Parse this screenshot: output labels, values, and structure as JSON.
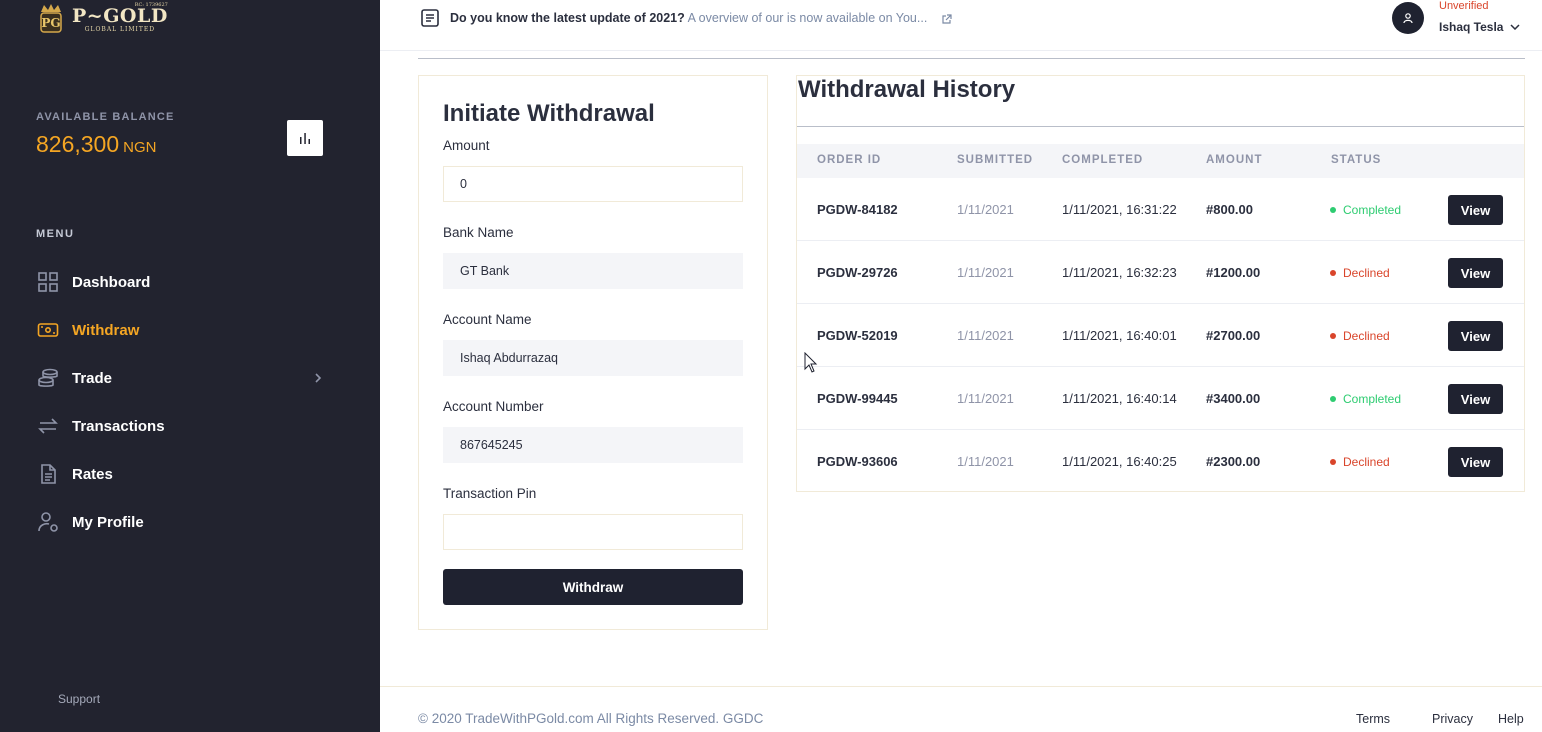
{
  "brand": {
    "name": "P~GOLD",
    "subtitle": "GLOBAL LIMITED",
    "rc": "RC: 1739627"
  },
  "balance": {
    "label": "AVAILABLE BALANCE",
    "amount": "826,300",
    "currency": "NGN"
  },
  "menu": {
    "label": "MENU",
    "items": [
      {
        "label": "Dashboard",
        "icon": "dashboard-icon"
      },
      {
        "label": "Withdraw",
        "icon": "wallet-icon",
        "active": true
      },
      {
        "label": "Trade",
        "icon": "coins-icon",
        "has_submenu": true
      },
      {
        "label": "Transactions",
        "icon": "transfer-icon"
      },
      {
        "label": "Rates",
        "icon": "document-icon"
      },
      {
        "label": "My Profile",
        "icon": "user-settings-icon"
      }
    ]
  },
  "support_label": "Support",
  "topbar": {
    "news_strong": "Do you know the latest update of 2021?",
    "news_link": "A overview of our is now available on You...",
    "user_status": "Unverified",
    "user_name": "Ishaq Tesla"
  },
  "form": {
    "title": "Initiate Withdrawal",
    "amount": {
      "label": "Amount",
      "value": "0"
    },
    "bank": {
      "label": "Bank Name",
      "value": "GT Bank"
    },
    "account_name": {
      "label": "Account Name",
      "value": "Ishaq Abdurrazaq"
    },
    "account_number": {
      "label": "Account Number",
      "value": "867645245"
    },
    "pin": {
      "label": "Transaction Pin",
      "value": ""
    },
    "submit_label": "Withdraw"
  },
  "history": {
    "title": "Withdrawal History",
    "columns": [
      "ORDER ID",
      "SUBMITTED",
      "COMPLETED",
      "AMOUNT",
      "STATUS"
    ],
    "view_label": "View",
    "rows": [
      {
        "order_id": "PGDW-84182",
        "submitted": "1/11/2021",
        "completed": "1/11/2021, 16:31:22",
        "amount": "#800.00",
        "status": "Completed"
      },
      {
        "order_id": "PGDW-29726",
        "submitted": "1/11/2021",
        "completed": "1/11/2021, 16:32:23",
        "amount": "#1200.00",
        "status": "Declined"
      },
      {
        "order_id": "PGDW-52019",
        "submitted": "1/11/2021",
        "completed": "1/11/2021, 16:40:01",
        "amount": "#2700.00",
        "status": "Declined"
      },
      {
        "order_id": "PGDW-99445",
        "submitted": "1/11/2021",
        "completed": "1/11/2021, 16:40:14",
        "amount": "#3400.00",
        "status": "Completed"
      },
      {
        "order_id": "PGDW-93606",
        "submitted": "1/11/2021",
        "completed": "1/11/2021, 16:40:25",
        "amount": "#2300.00",
        "status": "Declined"
      }
    ]
  },
  "footer": {
    "copyright": "© 2020 TradeWithPGold.com All Rights Reserved. GGDC",
    "links": [
      "Terms",
      "Privacy",
      "Help"
    ]
  },
  "colors": {
    "sidebar_bg": "#22232f",
    "accent": "#f5a623",
    "completed": "#2ecc71",
    "declined": "#d9452b",
    "button_bg": "#1f2230"
  }
}
